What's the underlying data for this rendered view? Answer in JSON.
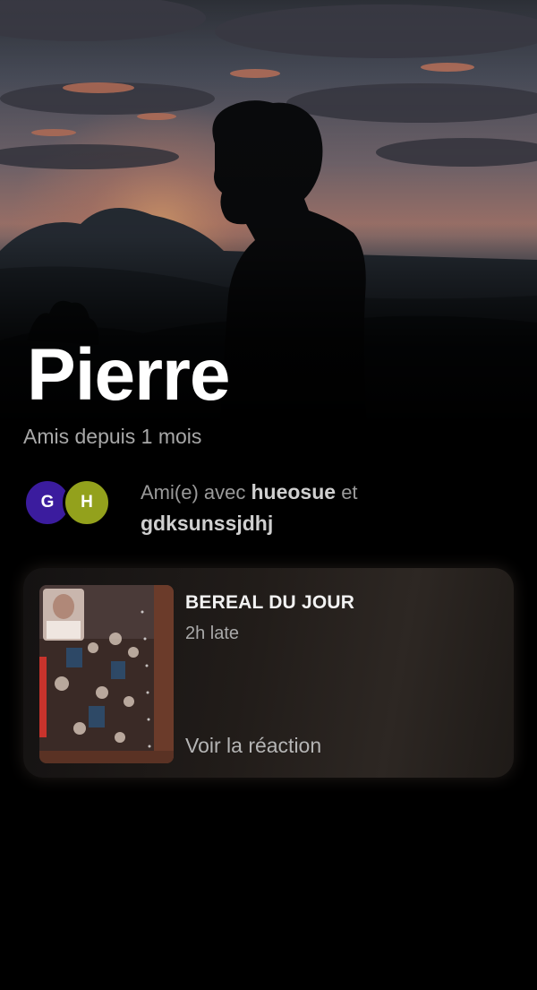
{
  "profile": {
    "name": "Pierre",
    "friend_since": "Amis depuis 1 mois"
  },
  "mutual_friends": {
    "avatars": [
      {
        "initial": "G",
        "color": "#3b1c9e"
      },
      {
        "initial": "H",
        "color": "#93a11c"
      }
    ],
    "prefix": "Ami(e) avec",
    "user1": "hueosue",
    "conjunction": "et",
    "user2": "gdksunssjdhj"
  },
  "bereal_card": {
    "title": "BEREAL DU JOUR",
    "late": "2h late",
    "action": "Voir la réaction"
  },
  "colors": {
    "background": "#000000",
    "secondary_text": "#a8a8a8"
  }
}
